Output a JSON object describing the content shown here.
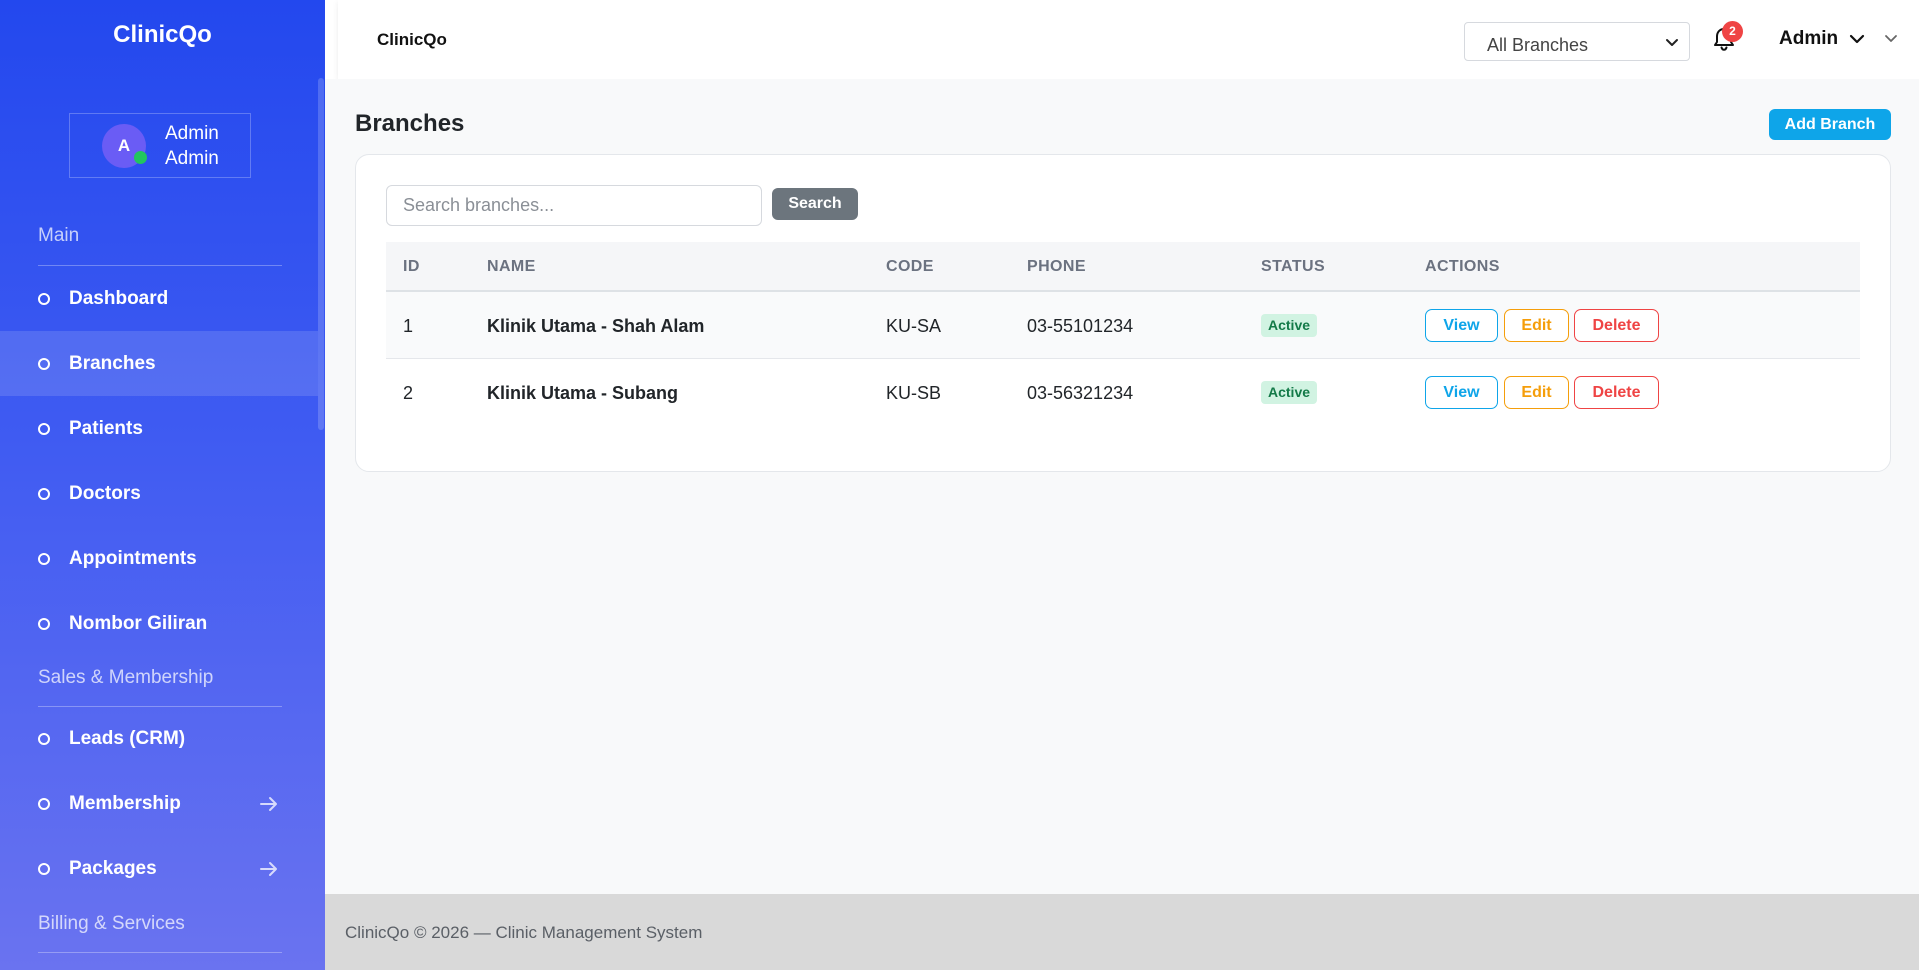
{
  "app": {
    "name": "ClinicQo"
  },
  "sidebar": {
    "brand": "ClinicQo",
    "user": {
      "avatar_initial": "A",
      "name": "Admin",
      "role": "Admin"
    },
    "sections": [
      {
        "title": "Main"
      },
      {
        "title": "Sales & Membership"
      },
      {
        "title": "Billing & Services"
      }
    ],
    "items": [
      {
        "label": "Dashboard",
        "active": false
      },
      {
        "label": "Branches",
        "active": true
      },
      {
        "label": "Patients",
        "active": false
      },
      {
        "label": "Doctors",
        "active": false
      },
      {
        "label": "Appointments",
        "active": false
      },
      {
        "label": "Nombor Giliran",
        "active": false
      },
      {
        "label": "Leads (CRM)",
        "active": false
      },
      {
        "label": "Membership",
        "active": false,
        "icon": "arrow-right-icon"
      },
      {
        "label": "Packages",
        "active": false,
        "icon": "arrow-right-icon"
      }
    ]
  },
  "header": {
    "title": "ClinicQo",
    "branch_select": {
      "value": "All Branches"
    },
    "notifications": {
      "icon": "bell-icon",
      "count": "2"
    },
    "user": {
      "name": "Admin"
    }
  },
  "page": {
    "title": "Branches",
    "add_button": "Add Branch",
    "search": {
      "placeholder": "Search branches...",
      "button": "Search"
    },
    "table": {
      "columns": [
        "ID",
        "NAME",
        "CODE",
        "PHONE",
        "STATUS",
        "ACTIONS"
      ],
      "rows": [
        {
          "id": "1",
          "name": "Klinik Utama - Shah Alam",
          "code": "KU-SA",
          "phone": "03-55101234",
          "status": "Active"
        },
        {
          "id": "2",
          "name": "Klinik Utama - Subang",
          "code": "KU-SB",
          "phone": "03-56321234",
          "status": "Active"
        }
      ],
      "actions": {
        "view": "View",
        "edit": "Edit",
        "delete": "Delete"
      }
    }
  },
  "footer": {
    "text": "ClinicQo © 2026 — Clinic Management System"
  },
  "colors": {
    "sidebar_gradient_top": "#2348ee",
    "sidebar_gradient_bottom": "#6a73f0",
    "primary": "#0ea5e9",
    "warning": "#f59e0b",
    "danger": "#ef4444",
    "success": "#137a48",
    "secondary": "#6c757d"
  }
}
